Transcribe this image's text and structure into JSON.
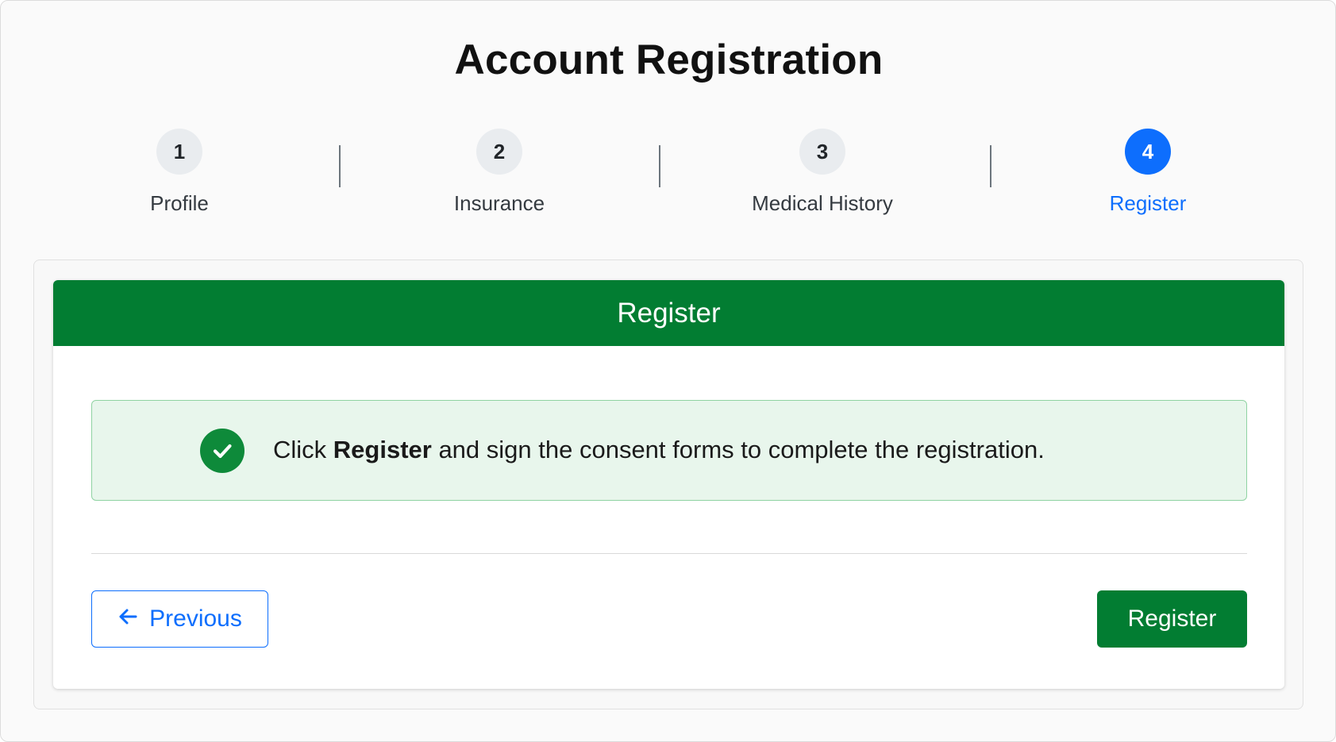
{
  "page": {
    "title": "Account Registration"
  },
  "stepper": {
    "steps": [
      {
        "number": "1",
        "label": "Profile"
      },
      {
        "number": "2",
        "label": "Insurance"
      },
      {
        "number": "3",
        "label": "Medical History"
      },
      {
        "number": "4",
        "label": "Register"
      }
    ],
    "active_step": "4"
  },
  "card": {
    "header": "Register",
    "alert": {
      "icon": "check-circle-icon",
      "text_prefix": "Click ",
      "text_bold": "Register",
      "text_suffix": " and sign the consent forms to complete the registration."
    },
    "previous_label": "Previous",
    "previous_icon": "arrow-left-icon",
    "register_label": "Register"
  },
  "colors": {
    "primary": "#0d6efd",
    "success": "#027d32",
    "alert_bg": "#e8f6ec"
  }
}
